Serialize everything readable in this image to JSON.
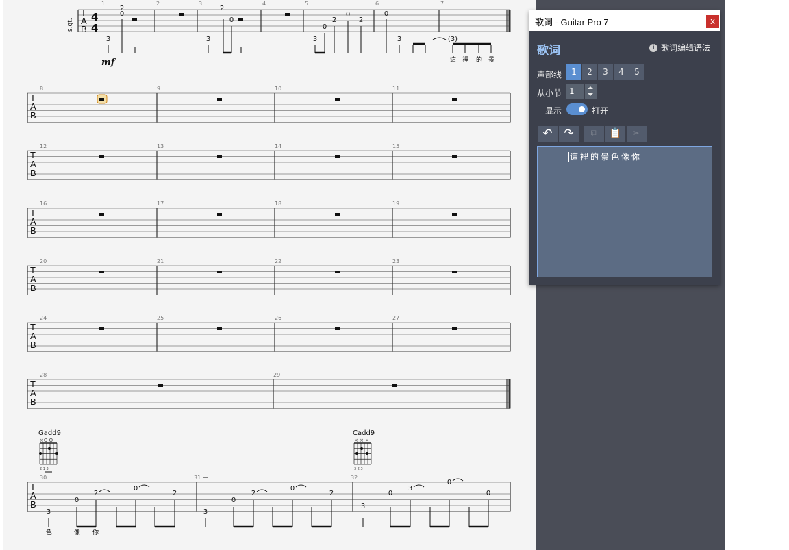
{
  "score": {
    "systems": [
      {
        "bars": [
          "1",
          "2",
          "3",
          "4",
          "5",
          "6",
          "7"
        ]
      },
      {
        "bars": [
          "8",
          "9",
          "10",
          "11"
        ]
      },
      {
        "bars": [
          "12",
          "13",
          "14",
          "15"
        ]
      },
      {
        "bars": [
          "16",
          "17",
          "18",
          "19"
        ]
      },
      {
        "bars": [
          "20",
          "21",
          "22",
          "23"
        ]
      },
      {
        "bars": [
          "24",
          "25",
          "26",
          "27"
        ]
      },
      {
        "bars": [
          "28",
          "29"
        ]
      },
      {
        "bars": [
          "30",
          "31",
          "32"
        ]
      }
    ],
    "time_signature": [
      "4",
      "4"
    ],
    "tab_letters": [
      "T",
      "A",
      "B"
    ],
    "dynamic": "mf",
    "staff_label": "s.gt.",
    "system1_numbers": [
      "2",
      "0",
      "3",
      "2",
      "0",
      "3",
      "0",
      "2",
      "0",
      "2",
      "3",
      "0",
      "3",
      "(3)"
    ],
    "system1_lyrics": [
      "這",
      "裡",
      "的",
      "景"
    ],
    "system8_numbers": [
      "3",
      "0",
      "2",
      "0",
      "2",
      "3",
      "0",
      "2",
      "0",
      "2",
      "3",
      "0",
      "3",
      "0",
      "0"
    ],
    "system8_lyrics": [
      "色",
      "像",
      "你"
    ],
    "chords": [
      {
        "name": "Gadd9",
        "top": "×O  O",
        "bottom": "2   1 3"
      },
      {
        "name": "Cadd9",
        "top": "×  ×  ×",
        "bottom": "3 2 3"
      }
    ]
  },
  "panel": {
    "title": "歌词 - Guitar Pro 7",
    "close": "x",
    "heading": "歌词",
    "syntax_link": "歌词编辑语法",
    "info_icon": "i",
    "voice_label": "声部线",
    "voices": [
      "1",
      "2",
      "3",
      "4",
      "5"
    ],
    "active_voice": "1",
    "from_bar_label": "从小节",
    "from_bar_value": "1",
    "show_label": "显示",
    "show_state": "打开",
    "toolbar": {
      "undo": "↶",
      "redo": "↷",
      "copy": "⧉",
      "paste": "📋",
      "cut": "✂"
    },
    "lyrics_text": "這裡的景色像你"
  },
  "colors": {
    "accent": "#5a8ed0",
    "panel_bg": "#3c404c",
    "editor_bg": "#5c6c84",
    "close_red": "#c9302c",
    "score_bg": "#f4f4f4"
  }
}
